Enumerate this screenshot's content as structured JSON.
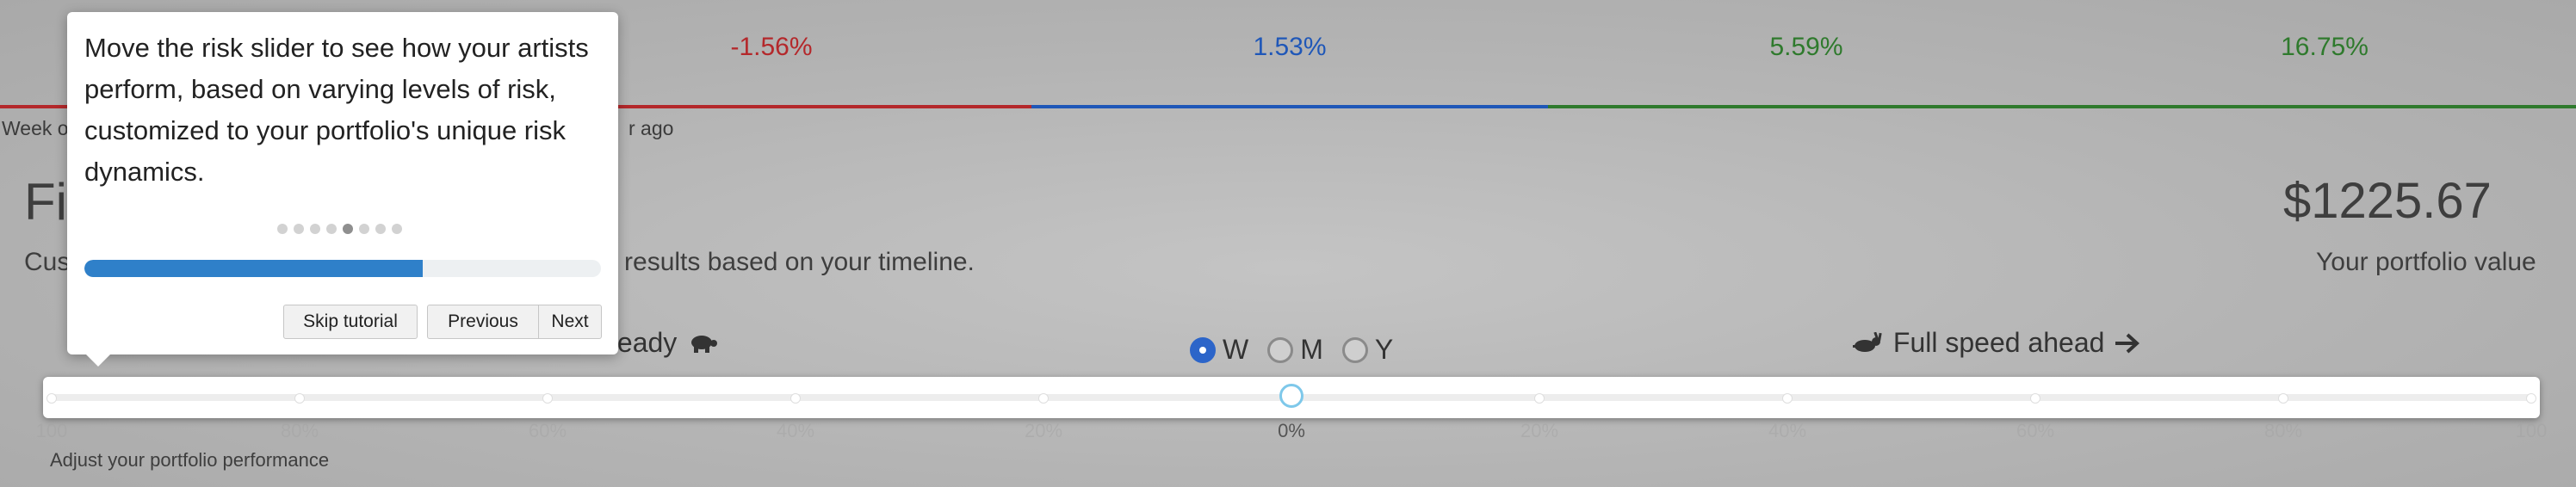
{
  "returns": [
    {
      "value": "-1.56%",
      "color": "#b4282b"
    },
    {
      "value": "1.53%",
      "color": "#1f57b8"
    },
    {
      "value": "5.59%",
      "color": "#2f7a2d"
    },
    {
      "value": "16.75%",
      "color": "#2f7a2d"
    }
  ],
  "time_labels": {
    "left": "Week o",
    "middle": "r ago"
  },
  "header": {
    "title_partial": "Fi",
    "description_partial": "Cus",
    "description_rest": "n results based on your timeline."
  },
  "portfolio": {
    "value": "$1225.67",
    "label": "Your portfolio value"
  },
  "slider": {
    "left_label": "teady",
    "left_icon": "turtle-icon",
    "right_label": "Full speed ahead",
    "right_icon": "rabbit-icon",
    "arrow_icon": "arrow-right-icon",
    "value": 0,
    "tick_labels": [
      "100",
      "80%",
      "60%",
      "40%",
      "20%",
      "0%",
      "20%",
      "40%",
      "60%",
      "80%",
      "100"
    ],
    "caption": "Adjust your portfolio performance"
  },
  "timeline": {
    "options": [
      {
        "label": "W",
        "selected": true
      },
      {
        "label": "M",
        "selected": false
      },
      {
        "label": "Y",
        "selected": false
      }
    ]
  },
  "tutorial": {
    "text": "Move the risk slider to see how your artists perform, based on varying levels of risk, customized to your portfolio's unique risk dynamics.",
    "step": 5,
    "total_steps": 8,
    "progress": 0.655,
    "buttons": {
      "skip": "Skip tutorial",
      "previous": "Previous",
      "next": "Next"
    }
  }
}
